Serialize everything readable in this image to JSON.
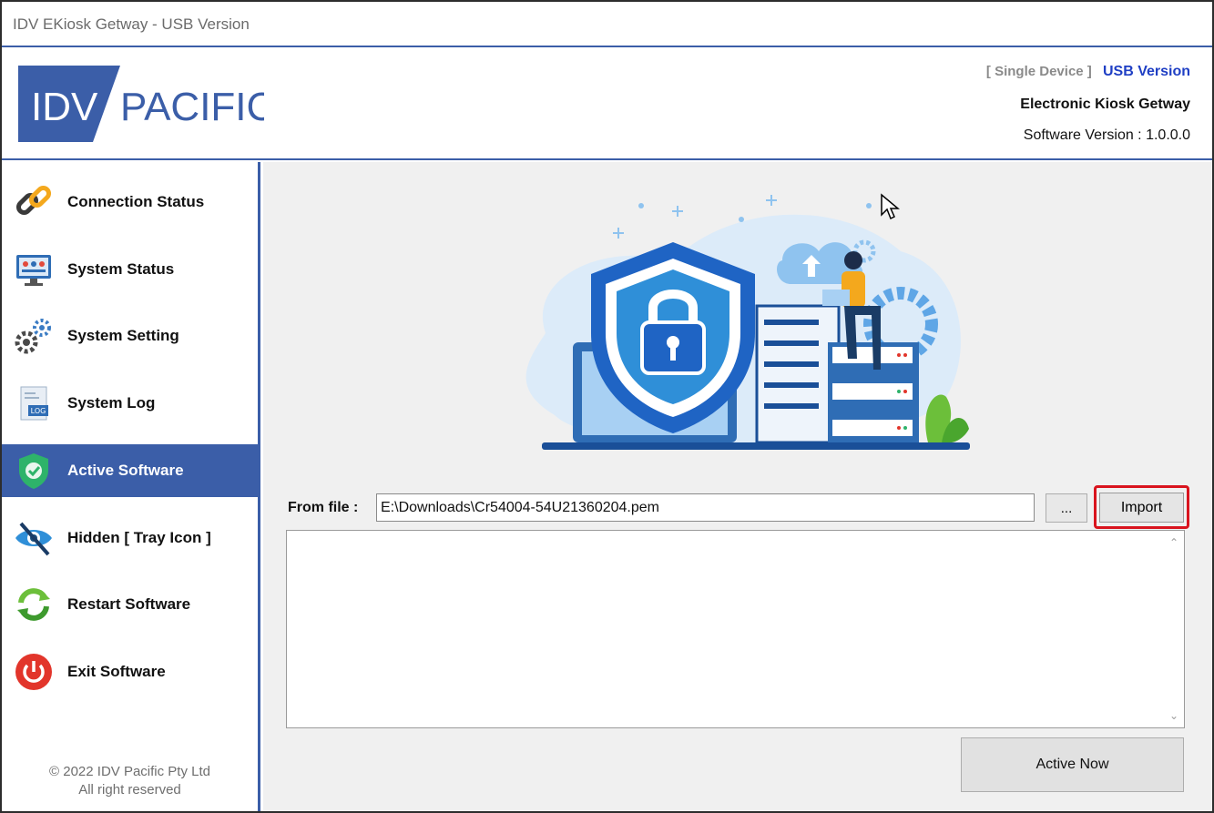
{
  "window": {
    "title": "IDV EKiosk Getway - USB Version"
  },
  "header": {
    "logo_text_left": "IDV",
    "logo_text_right": "PACIFIC",
    "device_mode": "[ Single Device ]",
    "version_type": "USB Version",
    "product_name": "Electronic Kiosk Getway",
    "software_version": "Software Version : 1.0.0.0"
  },
  "sidebar": {
    "items": [
      {
        "label": "Connection Status",
        "icon": "link-icon"
      },
      {
        "label": "System Status",
        "icon": "monitor-icon"
      },
      {
        "label": "System Setting",
        "icon": "gears-icon"
      },
      {
        "label": "System Log",
        "icon": "log-file-icon"
      },
      {
        "label": "Active Software",
        "icon": "shield-check-icon",
        "active": true
      },
      {
        "label": "Hidden [ Tray Icon ]",
        "icon": "eye-hidden-icon"
      },
      {
        "label": "Restart Software",
        "icon": "restart-icon"
      },
      {
        "label": "Exit Software",
        "icon": "power-icon"
      }
    ],
    "copyright_line1": "© 2022 IDV Pacific Pty Ltd",
    "copyright_line2": "All right reserved"
  },
  "main": {
    "from_file_label": "From file :",
    "file_path": "E:\\Downloads\\Cr54004-54U21360204.pem",
    "browse_label": "...",
    "import_label": "Import",
    "log_text": "",
    "active_now_label": "Active Now"
  },
  "colors": {
    "accent": "#3b5ea8",
    "highlight_border": "#d9141e",
    "usb_text": "#1f3fc4"
  }
}
